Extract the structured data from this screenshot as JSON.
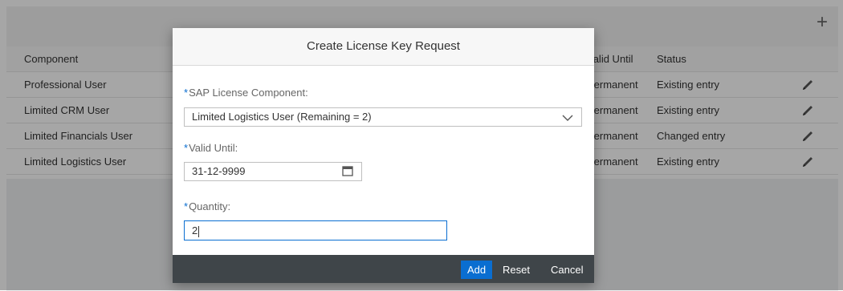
{
  "background": {
    "table": {
      "headers": {
        "component": "Component",
        "valid_until": "Valid Until",
        "status": "Status"
      },
      "rows": [
        {
          "component": "Professional User",
          "valid_until": "Permanent",
          "status": "Existing entry"
        },
        {
          "component": "Limited CRM User",
          "valid_until": "Permanent",
          "status": "Existing entry"
        },
        {
          "component": "Limited Financials User",
          "valid_until": "Permanent",
          "status": "Changed entry"
        },
        {
          "component": "Limited Logistics User",
          "valid_until": "Permanent",
          "status": "Existing entry"
        }
      ]
    },
    "add_icon": "+"
  },
  "dialog": {
    "title": "Create License Key Request",
    "required_mark": "*",
    "component_label": "SAP License Component:",
    "component_value": "Limited Logistics User (Remaining = 2)",
    "valid_until_label": "Valid Until:",
    "valid_until_value": "31-12-9999",
    "quantity_label": "Quantity:",
    "quantity_value": "2",
    "buttons": {
      "add": "Add",
      "reset": "Reset",
      "cancel": "Cancel"
    }
  },
  "colors": {
    "accent": "#0a6ed1",
    "footer_bg": "#3f4549",
    "overlay": "rgba(0,0,0,0.35)"
  },
  "icons": {
    "toolbar": "add-icon",
    "row_action": "edit-icon",
    "select": "chevron-down-icon",
    "date": "calendar-icon"
  }
}
